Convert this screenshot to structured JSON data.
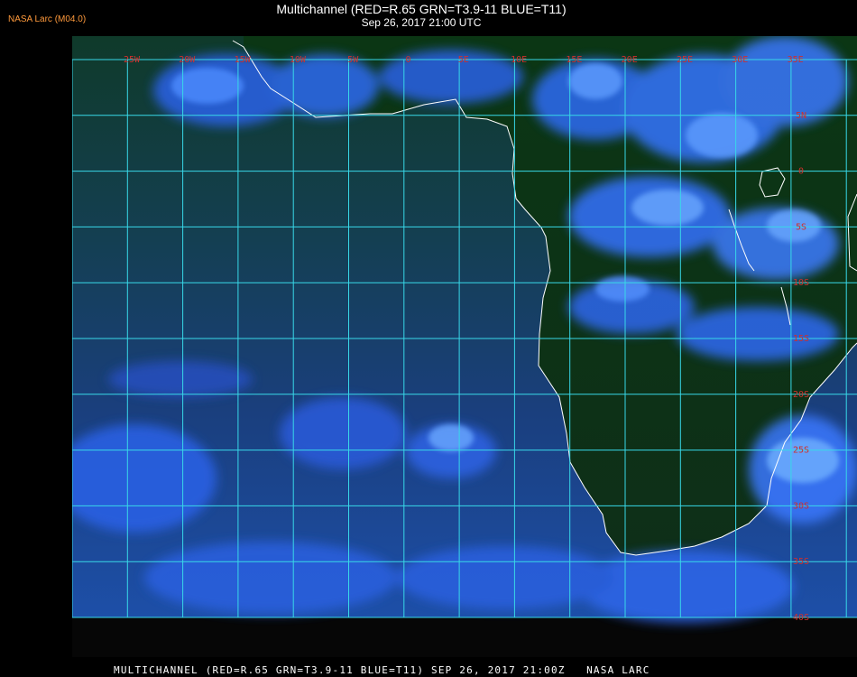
{
  "header": {
    "brand": "NASA Larc (M04.0)",
    "title": "Multichannel (RED=R.65 GRN=T3.9-11 BLUE=T11)",
    "subtitle": "Sep 26, 2017 21:00 UTC"
  },
  "footer": {
    "caption": "MULTICHANNEL (RED=R.65 GRN=T3.9-11 BLUE=T11) SEP 26, 2017 21:00Z   NASA LARC"
  },
  "map": {
    "region": "Southern Africa and South Atlantic",
    "longitude_labels": [
      "25W",
      "20W",
      "15W",
      "10W",
      "5W",
      "0",
      "5E",
      "10E",
      "15E",
      "20E",
      "25E",
      "30E",
      "35E"
    ],
    "latitude_labels": [
      "5N",
      "0",
      "5S",
      "10S",
      "15S",
      "20S",
      "25S",
      "30S",
      "35S",
      "40S"
    ],
    "colors": {
      "grid": "#38d8e8",
      "labels": "#d0302c",
      "coast": "#ffffff",
      "land": "#0c3a14",
      "ocean": "#113a5c",
      "cloud": "#2c6aff",
      "bright_cloud": "#5fa0ff",
      "frame": "#060606"
    }
  }
}
